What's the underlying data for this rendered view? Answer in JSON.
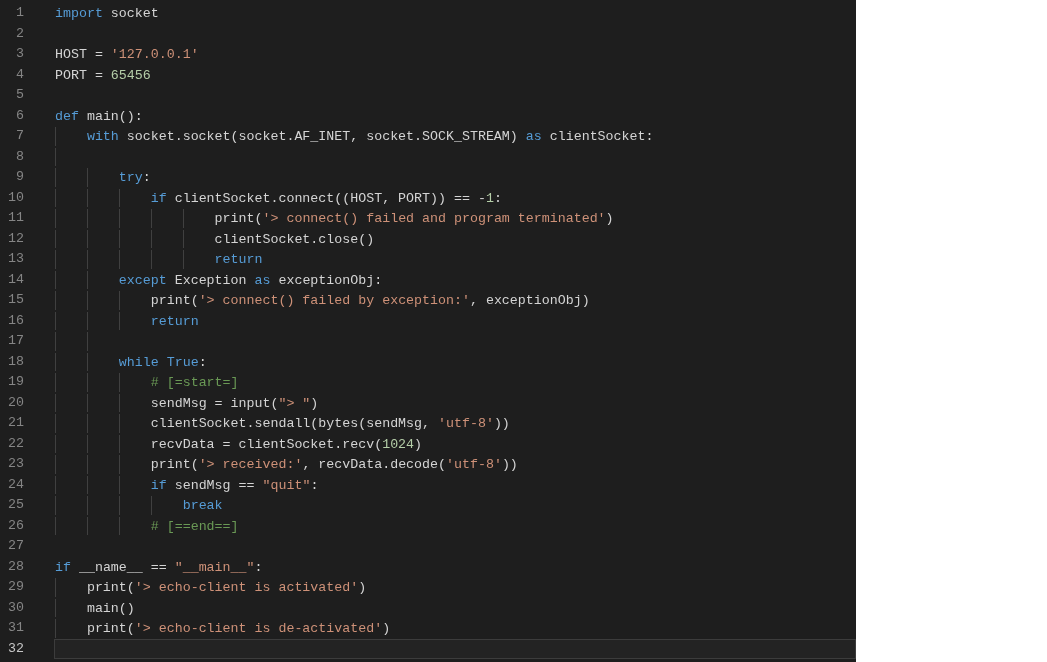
{
  "editor": {
    "lines": [
      {
        "number": "1",
        "current": false,
        "tokens": [
          {
            "kind": "keyword",
            "text": "import"
          },
          {
            "kind": "plain",
            "text": " socket"
          }
        ]
      },
      {
        "number": "2",
        "current": false
      },
      {
        "number": "3",
        "current": false,
        "tokens": [
          {
            "kind": "plain",
            "text": "HOST = "
          },
          {
            "kind": "string",
            "text": "'127.0.0.1'"
          }
        ]
      },
      {
        "number": "4",
        "current": false,
        "tokens": [
          {
            "kind": "plain",
            "text": "PORT = "
          },
          {
            "kind": "number",
            "text": "65456"
          }
        ]
      },
      {
        "number": "5",
        "current": false
      },
      {
        "number": "6",
        "current": false,
        "tokens": [
          {
            "kind": "keyword",
            "text": "def"
          },
          {
            "kind": "plain",
            "text": " main():"
          }
        ]
      },
      {
        "number": "7",
        "current": false,
        "tokens": [
          {
            "kind": "keyword",
            "text": "    with"
          },
          {
            "kind": "plain",
            "text": " socket.socket(socket.AF_INET, socket.SOCK_STREAM) "
          },
          {
            "kind": "keyword",
            "text": "as"
          },
          {
            "kind": "plain",
            "text": " clientSocket:"
          }
        ]
      },
      {
        "number": "8",
        "current": false
      },
      {
        "number": "9",
        "current": false,
        "tokens": [
          {
            "kind": "keyword",
            "text": "        try"
          },
          {
            "kind": "plain",
            "text": ":"
          }
        ]
      },
      {
        "number": "10",
        "current": false,
        "tokens": [
          {
            "kind": "keyword",
            "text": "            if"
          },
          {
            "kind": "plain",
            "text": " clientSocket.connect((HOST, PORT)) == -"
          },
          {
            "kind": "number",
            "text": "1"
          },
          {
            "kind": "plain",
            "text": ":"
          }
        ]
      },
      {
        "number": "11",
        "current": false,
        "tokens": [
          {
            "kind": "plain",
            "text": "                    print("
          },
          {
            "kind": "string",
            "text": "'> connect() failed and program terminated'"
          },
          {
            "kind": "plain",
            "text": ")"
          }
        ]
      },
      {
        "number": "12",
        "current": false,
        "tokens": [
          {
            "kind": "plain",
            "text": "                    clientSocket.close()"
          }
        ]
      },
      {
        "number": "13",
        "current": false,
        "tokens": [
          {
            "kind": "keyword",
            "text": "                    return"
          }
        ]
      },
      {
        "number": "14",
        "current": false,
        "tokens": [
          {
            "kind": "keyword",
            "text": "        except"
          },
          {
            "kind": "plain",
            "text": " Exception "
          },
          {
            "kind": "keyword",
            "text": "as"
          },
          {
            "kind": "plain",
            "text": " exceptionObj:"
          }
        ]
      },
      {
        "number": "15",
        "current": false,
        "tokens": [
          {
            "kind": "plain",
            "text": "            print("
          },
          {
            "kind": "string",
            "text": "'> connect() failed by exception:'"
          },
          {
            "kind": "plain",
            "text": ", exceptionObj)"
          }
        ]
      },
      {
        "number": "16",
        "current": false,
        "tokens": [
          {
            "kind": "keyword",
            "text": "            return"
          }
        ]
      },
      {
        "number": "17",
        "current": false
      },
      {
        "number": "18",
        "current": false,
        "tokens": [
          {
            "kind": "keyword",
            "text": "        while True"
          },
          {
            "kind": "plain",
            "text": ":"
          }
        ]
      },
      {
        "number": "19",
        "current": false,
        "tokens": [
          {
            "kind": "comment",
            "text": "            # [=start=]"
          }
        ]
      },
      {
        "number": "20",
        "current": false,
        "tokens": [
          {
            "kind": "plain",
            "text": "            sendMsg = input("
          },
          {
            "kind": "string",
            "text": "\"> \""
          },
          {
            "kind": "plain",
            "text": ")"
          }
        ]
      },
      {
        "number": "21",
        "current": false,
        "tokens": [
          {
            "kind": "plain",
            "text": "            clientSocket.sendall(bytes(sendMsg, "
          },
          {
            "kind": "string",
            "text": "'utf-8'"
          },
          {
            "kind": "plain",
            "text": "))"
          }
        ]
      },
      {
        "number": "22",
        "current": false,
        "tokens": [
          {
            "kind": "plain",
            "text": "            recvData = clientSocket.recv("
          },
          {
            "kind": "number",
            "text": "1024"
          },
          {
            "kind": "plain",
            "text": ")"
          }
        ]
      },
      {
        "number": "23",
        "current": false,
        "tokens": [
          {
            "kind": "plain",
            "text": "            print("
          },
          {
            "kind": "string",
            "text": "'> received:'"
          },
          {
            "kind": "plain",
            "text": ", recvData.decode("
          },
          {
            "kind": "string",
            "text": "'utf-8'"
          },
          {
            "kind": "plain",
            "text": "))"
          }
        ]
      },
      {
        "number": "24",
        "current": false,
        "tokens": [
          {
            "kind": "keyword",
            "text": "            if"
          },
          {
            "kind": "plain",
            "text": " sendMsg == "
          },
          {
            "kind": "string",
            "text": "\"quit\""
          },
          {
            "kind": "plain",
            "text": ":"
          }
        ]
      },
      {
        "number": "25",
        "current": false,
        "tokens": [
          {
            "kind": "keyword",
            "text": "                break"
          }
        ]
      },
      {
        "number": "26",
        "current": false,
        "tokens": [
          {
            "kind": "comment",
            "text": "            # [==end==]"
          }
        ]
      },
      {
        "number": "27",
        "current": false
      },
      {
        "number": "28",
        "current": false,
        "tokens": [
          {
            "kind": "keyword",
            "text": "if"
          },
          {
            "kind": "plain",
            "text": " __name__ == "
          },
          {
            "kind": "string",
            "text": "\"__main__\""
          },
          {
            "kind": "plain",
            "text": ":"
          }
        ]
      },
      {
        "number": "29",
        "current": false,
        "tokens": [
          {
            "kind": "plain",
            "text": "    print("
          },
          {
            "kind": "string",
            "text": "'> echo-client is activated'"
          },
          {
            "kind": "plain",
            "text": ")"
          }
        ]
      },
      {
        "number": "30",
        "current": false,
        "tokens": [
          {
            "kind": "plain",
            "text": "    main()"
          }
        ]
      },
      {
        "number": "31",
        "current": false,
        "tokens": [
          {
            "kind": "plain",
            "text": "    print("
          },
          {
            "kind": "string",
            "text": "'> echo-client is de-activated'"
          },
          {
            "kind": "plain",
            "text": ")"
          }
        ]
      },
      {
        "number": "32",
        "current": true
      }
    ]
  }
}
